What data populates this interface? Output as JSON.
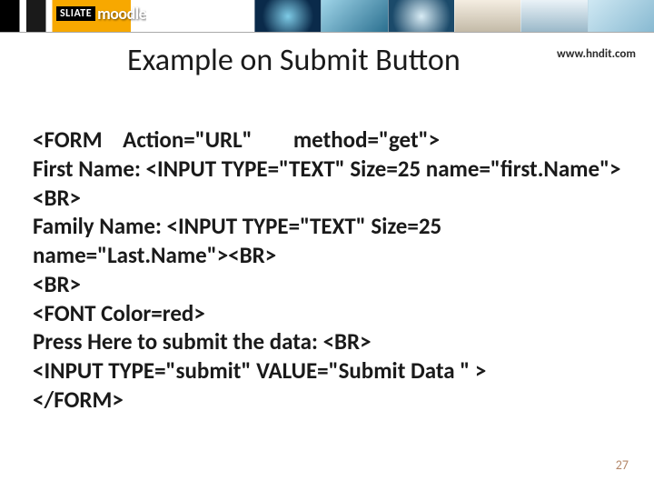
{
  "header": {
    "logo_sliate": "SLIATE",
    "logo_moodle": "moodle"
  },
  "title_row": {
    "title": "Example on Submit Button",
    "site_url": "www.hndit.com"
  },
  "code": {
    "line1": "<FORM    Action=\"URL\"        method=\"get\">",
    "line2": "First Name: <INPUT TYPE=\"TEXT\" Size=25 name=\"first.Name\"><BR>",
    "line3": "Family Name: <INPUT TYPE=\"TEXT\" Size=25 name=\"Last.Name\"><BR>",
    "line4": "<BR>",
    "line5": "<FONT Color=red>",
    "line6": "Press Here to submit the data: <BR>",
    "line7": "<INPUT TYPE=\"submit\" VALUE=\"Submit Data \" >",
    "line8": "</FORM>"
  },
  "footer": {
    "slide_number": "27"
  }
}
